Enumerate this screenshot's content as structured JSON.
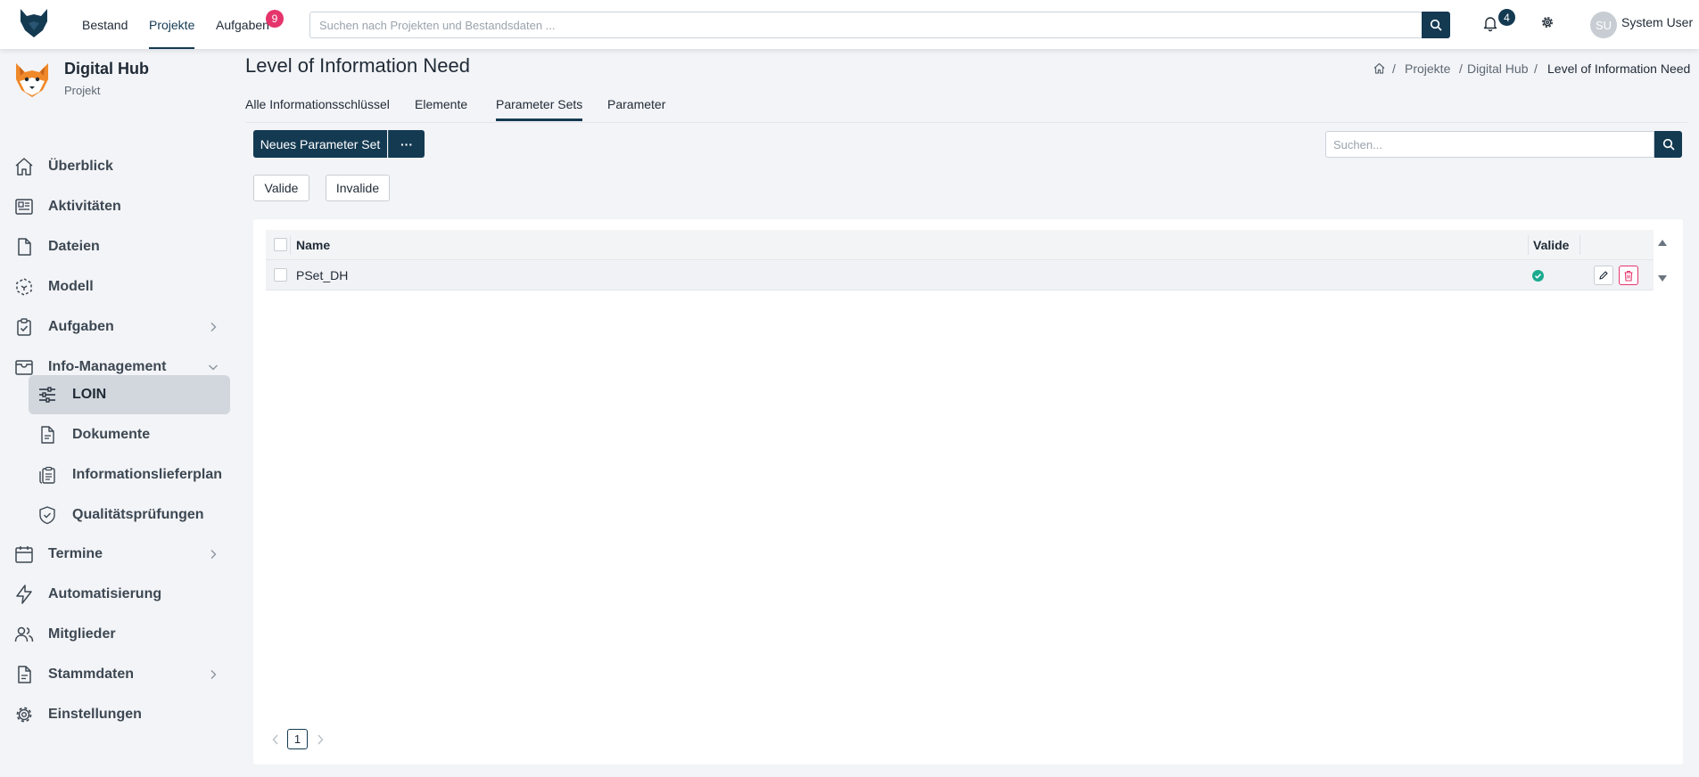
{
  "topbar": {
    "nav": [
      "Bestand",
      "Projekte",
      "Aufgaben"
    ],
    "tasks_badge": "9",
    "search_placeholder": "Suchen nach Projekten und Bestandsdaten ...",
    "notifications_badge": "4",
    "user_initials": "SU",
    "user_name": "System User"
  },
  "project": {
    "name": "Digital Hub",
    "type": "Projekt"
  },
  "sidebar": {
    "items": [
      {
        "label": "Überblick",
        "icon": "home-icon"
      },
      {
        "label": "Aktivitäten",
        "icon": "newspaper-icon"
      },
      {
        "label": "Dateien",
        "icon": "file-icon"
      },
      {
        "label": "Modell",
        "icon": "cube-icon"
      },
      {
        "label": "Aufgaben",
        "icon": "clipboard-check-icon"
      },
      {
        "label": "Info-Management",
        "icon": "inbox-icon"
      },
      {
        "label": "Termine",
        "icon": "calendar-icon"
      },
      {
        "label": "Automatisierung",
        "icon": "lightning-icon"
      },
      {
        "label": "Mitglieder",
        "icon": "users-icon"
      },
      {
        "label": "Stammdaten",
        "icon": "document-icon"
      },
      {
        "label": "Einstellungen",
        "icon": "gear-icon"
      }
    ],
    "sub_items": [
      {
        "label": "LOIN",
        "icon": "sliders-icon",
        "active": true
      },
      {
        "label": "Dokumente",
        "icon": "document-icon"
      },
      {
        "label": "Informationslieferplan",
        "icon": "copy-list-icon"
      },
      {
        "label": "Qualitätsprüfungen",
        "icon": "shield-check-icon"
      }
    ]
  },
  "page": {
    "title": "Level of Information Need",
    "breadcrumb": [
      "Projekte",
      "Digital Hub",
      "Level of Information Need"
    ],
    "tabs": [
      "Alle Informationsschlüssel",
      "Elemente",
      "Parameter Sets",
      "Parameter"
    ],
    "active_tab": "Parameter Sets"
  },
  "toolbar": {
    "new_button": "Neues Parameter Set",
    "more_button": "···",
    "search_placeholder": "Suchen..."
  },
  "filters": [
    "Valide",
    "Invalide"
  ],
  "table": {
    "columns": [
      "Name",
      "Valide"
    ],
    "rows": [
      {
        "name": "PSet_DH",
        "valid": true
      }
    ]
  },
  "pagination": {
    "current": "1"
  },
  "colors": {
    "primary": "#143a52",
    "badge": "#e5346b",
    "valid": "#1aaa8f",
    "delete": "#e5346b"
  }
}
